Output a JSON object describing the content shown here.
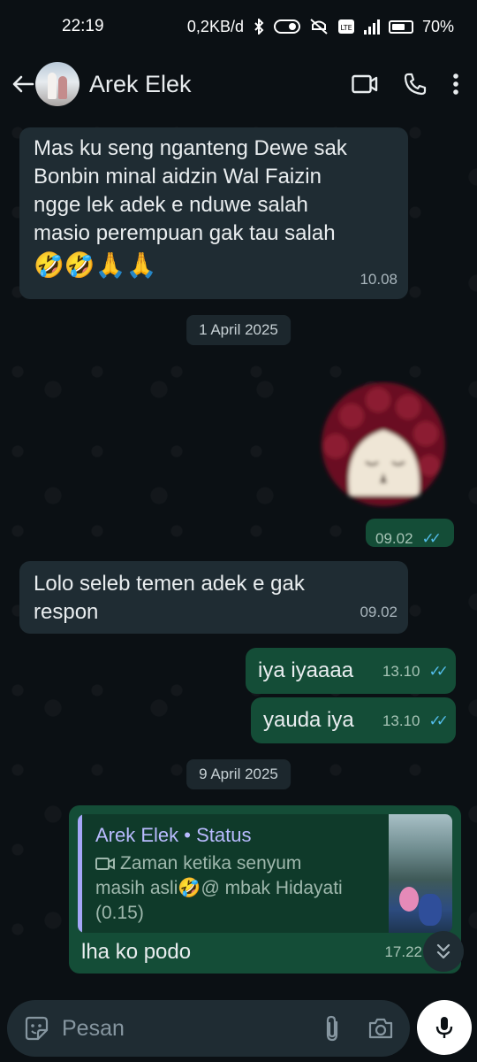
{
  "status_bar": {
    "time": "22:19",
    "network_speed": "0,2KB/d",
    "battery": "70%",
    "battery_level": 0.7,
    "network_type": "4G+"
  },
  "header": {
    "contact_name": "Arek Elek",
    "back_icon": "arrow-left-icon",
    "video_icon": "video-camera-icon",
    "call_icon": "phone-icon",
    "menu_icon": "more-vertical-icon"
  },
  "messages": [
    {
      "direction": "in",
      "lines": [
        "Mas ku seng nganteng Dewe sak",
        "Bonbin minal aidzin Wal Faizin",
        "ngge lek adek e nduwe salah",
        "masio perempuan gak tau salah"
      ],
      "emoji": "🤣🤣🙏🙏",
      "time": "10.08"
    },
    {
      "date_divider": "1 April 2025"
    },
    {
      "direction": "out",
      "type": "sticker",
      "time": "09.02",
      "status": "read"
    },
    {
      "direction": "in",
      "lines": [
        "Lolo seleb temen adek e gak",
        "respon"
      ],
      "time": "09.02"
    },
    {
      "direction": "out",
      "text": "iya iyaaaa",
      "time": "13.10",
      "status": "read"
    },
    {
      "direction": "out",
      "text": "yauda iya",
      "time": "13.10",
      "status": "read"
    },
    {
      "date_divider": "9 April 2025"
    },
    {
      "direction": "out",
      "quoted": {
        "author": "Arek Elek • Status",
        "lines": [
          "Zaman ketika senyum",
          "masih asli🤣@ mbak Hidayati",
          "(0.15)"
        ],
        "icon": "video-small-icon"
      },
      "text": "lha ko podo",
      "time": "17.22"
    }
  ],
  "input": {
    "placeholder": "Pesan",
    "emoji_icon": "sticker-smiley-icon",
    "attach_icon": "paperclip-icon",
    "camera_icon": "camera-icon",
    "mic_icon": "microphone-icon"
  },
  "colors": {
    "background": "#0b1014",
    "incoming_bubble": "#1f2c33",
    "outgoing_bubble": "#144d37",
    "read_ticks": "#53bdeb",
    "status_author": "#b9bbff"
  }
}
